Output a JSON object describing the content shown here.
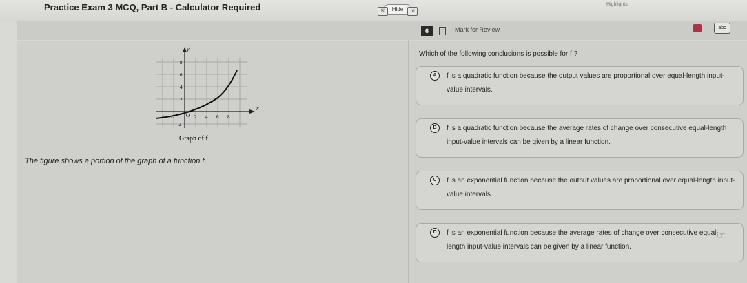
{
  "header": {
    "exam_title": "Practice Exam 3 MCQ, Part B - Calculator Required",
    "hide_label": "Hide",
    "highlights_label": "Highlights"
  },
  "toolbar": {
    "question_number": "6",
    "mark_for_review": "Mark for Review",
    "annotate_label": "abc"
  },
  "stimulus": {
    "graph_caption": "Graph of f",
    "axis_x": "x",
    "axis_y": "y",
    "x_ticks": [
      "-4",
      "-2",
      "O",
      "2",
      "4",
      "6",
      "8"
    ],
    "y_ticks": [
      "-2",
      "2",
      "4",
      "6",
      "8"
    ],
    "text": "The figure shows a portion of the graph of a function f."
  },
  "question": {
    "prompt": "Which of the following conclusions is possible for f ?",
    "choices": [
      {
        "letter": "A",
        "text": "f is a quadratic function because the output values are proportional over equal-length input-value intervals."
      },
      {
        "letter": "B",
        "text": "f is a quadratic function because the average rates of change over consecutive equal-length input-value intervals can be given by a linear function."
      },
      {
        "letter": "C",
        "text": "f is an exponential function because the output values are proportional over equal-length input-value intervals."
      },
      {
        "letter": "D",
        "text": "f is an exponential function because the average rates of change over consecutive equal-length input-value intervals can be given by a linear function."
      }
    ]
  },
  "colors": {
    "background": "#cfd0cc",
    "question_badge": "#2a2a2a",
    "calculator_icon": "#aa3344"
  }
}
